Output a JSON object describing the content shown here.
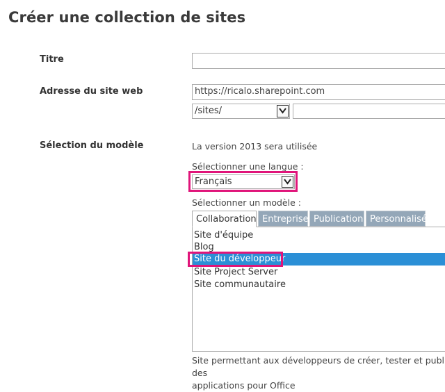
{
  "page": {
    "title": "Créer une collection de sites"
  },
  "form": {
    "title_label": "Titre",
    "title_value": "",
    "address_label": "Adresse du site web",
    "address_prefix": "https://ricalo.sharepoint.com",
    "path_select": "/sites/",
    "path_value": "",
    "template_label": "Sélection du modèle",
    "version_note": "La version 2013 sera utilisée",
    "language_label": "Sélectionner une langue :",
    "language_value": "Français",
    "template_select_label": "Sélectionner un modèle :",
    "tabs": [
      {
        "label": "Collaboration",
        "active": true
      },
      {
        "label": "Entreprise",
        "active": false
      },
      {
        "label": "Publication",
        "active": false
      },
      {
        "label": "Personnalisé",
        "active": false
      }
    ],
    "templates": [
      {
        "label": "Site d'équipe",
        "selected": false
      },
      {
        "label": "Blog",
        "selected": false
      },
      {
        "label": "Site du développeur",
        "selected": true
      },
      {
        "label": "Site Project Server",
        "selected": false
      },
      {
        "label": "Site communautaire",
        "selected": false
      }
    ],
    "description_line1": "Site permettant aux développeurs de créer, tester et publier des",
    "description_line2": "applications pour Office"
  },
  "colors": {
    "highlight": "#e0157a",
    "selection": "#2b8fd6",
    "inactive_tab": "#94a7b8"
  }
}
